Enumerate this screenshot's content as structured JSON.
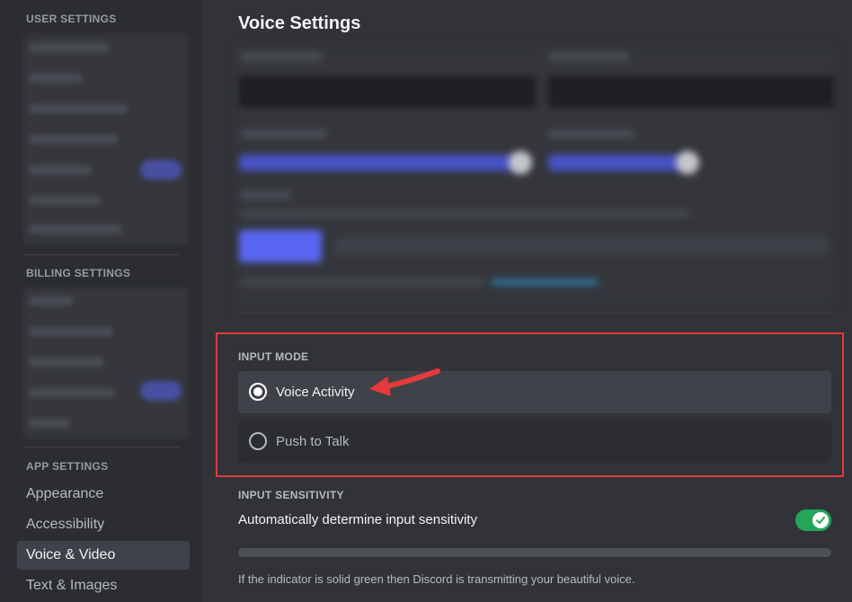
{
  "sidebar": {
    "user_settings_header": "USER SETTINGS",
    "billing_settings_header": "BILLING SETTINGS",
    "app_settings_header": "APP SETTINGS",
    "app_items": [
      {
        "label": "Appearance",
        "active": false
      },
      {
        "label": "Accessibility",
        "active": false
      },
      {
        "label": "Voice & Video",
        "active": true
      },
      {
        "label": "Text & Images",
        "active": false
      }
    ]
  },
  "main": {
    "title": "Voice Settings",
    "input_mode": {
      "label": "INPUT MODE",
      "options": [
        {
          "label": "Voice Activity",
          "selected": true
        },
        {
          "label": "Push to Talk",
          "selected": false
        }
      ]
    },
    "input_sensitivity": {
      "label": "INPUT SENSITIVITY",
      "auto_label": "Automatically determine input sensitivity",
      "auto_enabled": true,
      "helper": "If the indicator is solid green then Discord is transmitting your beautiful voice."
    }
  },
  "colors": {
    "accent": "#5865f2",
    "toggle_on": "#23a55a",
    "highlight": "#e5393b"
  }
}
